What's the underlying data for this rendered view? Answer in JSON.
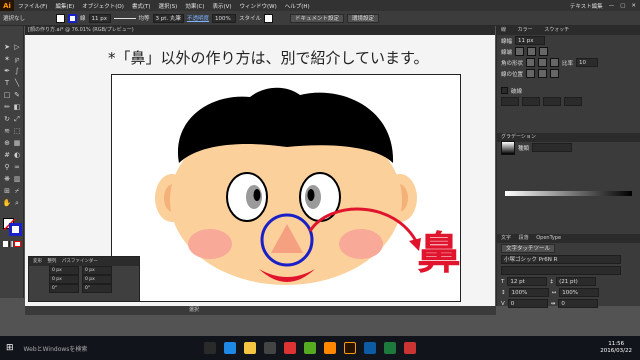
{
  "app": {
    "logo": "Ai",
    "workspace": "テキスト編集"
  },
  "menu": [
    "ファイル(F)",
    "編集(E)",
    "オブジェクト(O)",
    "書式(T)",
    "選択(S)",
    "効果(C)",
    "表示(V)",
    "ウィンドウ(W)",
    "ヘルプ(H)"
  ],
  "control": {
    "selection": "選択なし",
    "line_label": "線",
    "stroke_weight": "11 px",
    "stroke_style": "均等",
    "brush": "3 pt. 丸筆",
    "opacity_label": "不透明度",
    "opacity": "100%",
    "style_label": "スタイル",
    "doc_settings": "ドキュメント設定",
    "env_settings": "環境設定"
  },
  "document": {
    "tab": "[顔の作り方.ai* @ 76.01% (RGB/プレビュー)"
  },
  "canvas": {
    "caption": "*「鼻」以外の作り方は、別で紹介しています。",
    "nose_label": "鼻"
  },
  "right_panel": {
    "tabs": [
      "線",
      "カラー",
      "スウォッチ"
    ],
    "weight_label": "線幅",
    "weight": "11 px",
    "cap_label": "線端",
    "corner_label": "角の形状",
    "ratio_label": "比率",
    "ratio": "10",
    "align_label": "線の位置",
    "dash_label": "破線",
    "gradient_tab": "グラデーション",
    "gradient_type": "種類",
    "char_tab": "文字",
    "para_tab": "段落",
    "opentype_tab": "OpenType",
    "char_search": "文字タッチツール",
    "font_name": "小塚ゴシック Pr6N R",
    "font_size": "12 pt",
    "leading": "(21 pt)",
    "h_scale": "100%",
    "v_scale": "100%",
    "tracking": "0",
    "kerning": "0"
  },
  "transform_panel": {
    "tabs": [
      "変形",
      "整列",
      "パスファインダー"
    ],
    "x": "0 px",
    "y": "0 px",
    "w": "0 px",
    "h": "0 px",
    "angle": "0°",
    "shear": "0°"
  },
  "status": {
    "mode": "選択"
  },
  "taskbar": {
    "watermark": "WebとWindowsを検索",
    "time": "11:56",
    "date": "2016/03/22"
  },
  "colors": {
    "accent": "#ff9a00",
    "skin": "#fbd09a",
    "hair": "#000000",
    "red": "#e0142c",
    "blue": "#1a20c8"
  }
}
